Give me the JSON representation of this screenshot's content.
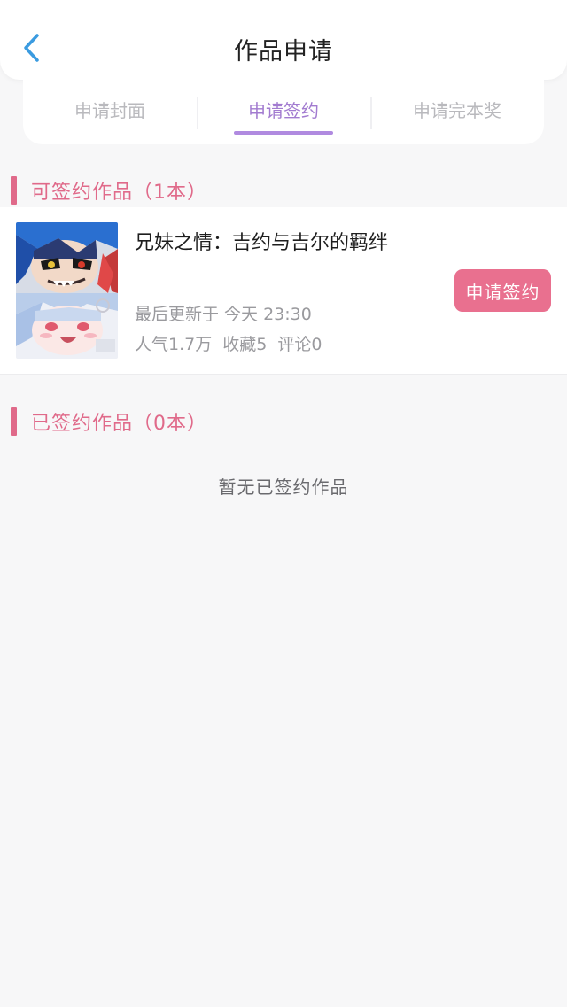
{
  "header": {
    "title": "作品申请",
    "back_icon": "chevron-left-icon",
    "accent_color": "#3a9be0"
  },
  "tabs": [
    {
      "label": "申请封面",
      "active": false
    },
    {
      "label": "申请签约",
      "active": true
    },
    {
      "label": "申请完本奖",
      "active": false
    }
  ],
  "signable_section": {
    "title": "可签约作品（1本）",
    "items": [
      {
        "title": "兄妹之情：吉约与吉尔的羁绊",
        "update": "最后更新于 今天 23:30",
        "popularity": "人气1.7万",
        "favorites": "收藏5",
        "comments": "评论0",
        "action_label": "申请签约"
      }
    ]
  },
  "signed_section": {
    "title": "已签约作品（0本）",
    "empty_text": "暂无已签约作品"
  },
  "colors": {
    "section_accent": "#e06a8a",
    "tab_active": "#a27bd0",
    "button": "#e9708f"
  }
}
